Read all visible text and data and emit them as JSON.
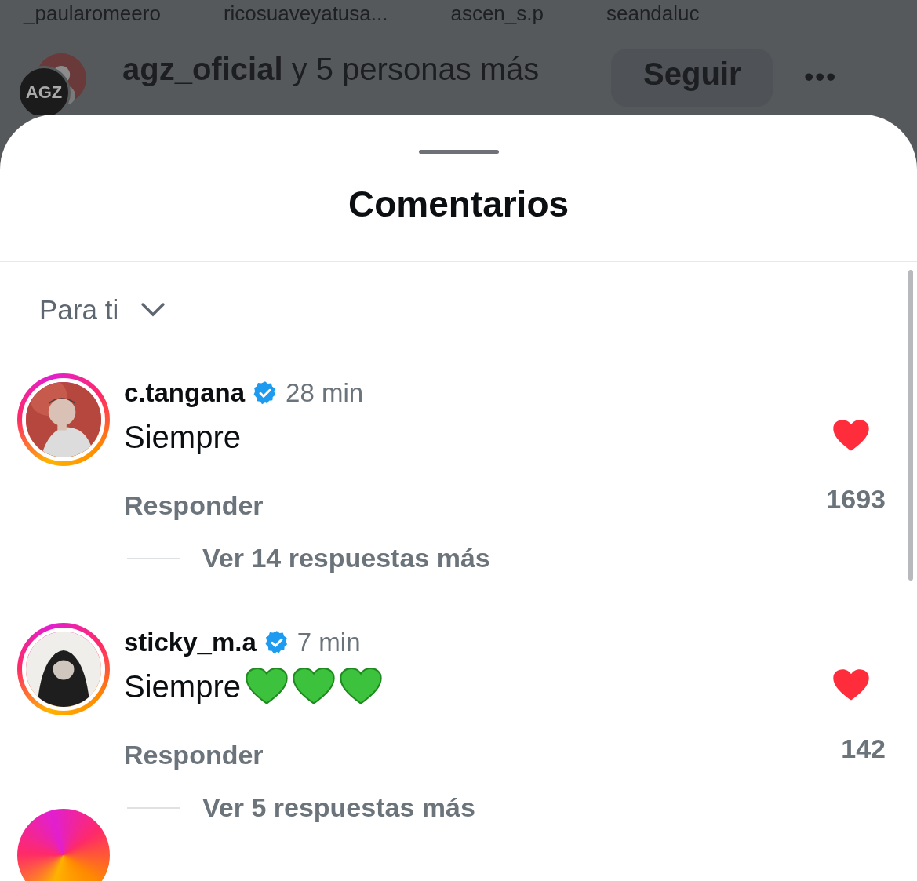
{
  "background": {
    "usernames": [
      "_paularomeero",
      "ricosuaveyatusa...",
      "ascen_s.p",
      "seandaluc"
    ],
    "liked_by": {
      "user": "agz_oficial",
      "rest": "y 5 personas más",
      "avatar_text": "AGZ"
    },
    "follow_button": "Seguir",
    "more_button": "•••"
  },
  "sheet": {
    "title": "Comentarios",
    "sort": "Para ti"
  },
  "comments": [
    {
      "username": "c.tangana",
      "verified": true,
      "time": "28 min",
      "text": "Siempre",
      "liked": true,
      "likes": "1693",
      "reply": "Responder",
      "replies": "Ver 14 respuestas más",
      "story_ring": true
    },
    {
      "username": "sticky_m.a",
      "verified": true,
      "time": "7 min",
      "text": "Siempre",
      "emojis": [
        {
          "kind": "green_heart"
        },
        {
          "kind": "green_heart"
        },
        {
          "kind": "green_heart"
        }
      ],
      "liked": true,
      "likes": "142",
      "reply": "Responder",
      "replies": "Ver 5 respuestas más",
      "story_ring": true
    }
  ],
  "partial_comment": {
    "story_ring": true
  }
}
